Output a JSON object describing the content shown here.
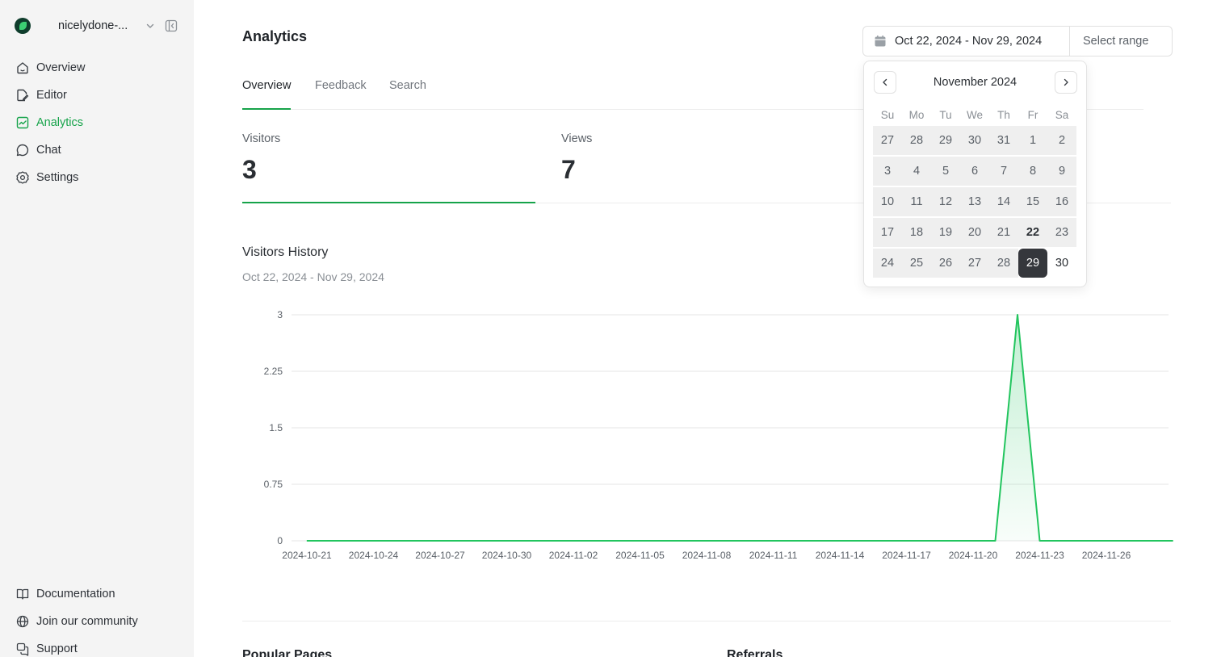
{
  "sidebar": {
    "org_name": "nicelydone-...",
    "items": [
      {
        "label": "Overview",
        "icon": "home-icon"
      },
      {
        "label": "Editor",
        "icon": "edit-icon"
      },
      {
        "label": "Analytics",
        "icon": "chart-icon",
        "active": true
      },
      {
        "label": "Chat",
        "icon": "chat-icon"
      },
      {
        "label": "Settings",
        "icon": "gear-icon"
      }
    ],
    "footer_items": [
      {
        "label": "Documentation",
        "icon": "book-icon"
      },
      {
        "label": "Join our community",
        "icon": "globe-icon"
      },
      {
        "label": "Support",
        "icon": "support-icon"
      }
    ]
  },
  "header": {
    "title": "Analytics",
    "date_range": "Oct 22, 2024 - Nov 29, 2024",
    "select_range": "Select range"
  },
  "tabs": [
    "Overview",
    "Feedback",
    "Search"
  ],
  "stats": [
    {
      "label": "Visitors",
      "value": "3"
    },
    {
      "label": "Views",
      "value": "7"
    }
  ],
  "history": {
    "title": "Visitors History",
    "subtitle": "Oct 22, 2024 - Nov 29, 2024"
  },
  "chart_data": {
    "type": "area",
    "title": "",
    "xlabel": "",
    "ylabel": "",
    "ylim": [
      0,
      3
    ],
    "y_ticks": [
      "0",
      "0.75",
      "1.5",
      "2.25",
      "3"
    ],
    "x_ticks": [
      "2024-10-21",
      "2024-10-24",
      "2024-10-27",
      "2024-10-30",
      "2024-11-02",
      "2024-11-05",
      "2024-11-08",
      "2024-11-11",
      "2024-11-14",
      "2024-11-17",
      "2024-11-20",
      "2024-11-23",
      "2024-11-26"
    ],
    "x": [
      "2024-10-21",
      "2024-11-20",
      "2024-11-21",
      "2024-11-22",
      "2024-11-23",
      "2024-11-24",
      "2024-11-25",
      "2024-11-26",
      "2024-11-27",
      "2024-11-28",
      "2024-11-29"
    ],
    "values": [
      0,
      0,
      0,
      3,
      0,
      0,
      0,
      0,
      0,
      0,
      0
    ],
    "grid": true,
    "color": "#22c55e"
  },
  "calendar": {
    "month": "November 2024",
    "weekdays": [
      "Su",
      "Mo",
      "Tu",
      "We",
      "Th",
      "Fr",
      "Sa"
    ],
    "weeks": [
      [
        "27",
        "28",
        "29",
        "30",
        "31",
        "1",
        "2"
      ],
      [
        "3",
        "4",
        "5",
        "6",
        "7",
        "8",
        "9"
      ],
      [
        "10",
        "11",
        "12",
        "13",
        "14",
        "15",
        "16"
      ],
      [
        "17",
        "18",
        "19",
        "20",
        "21",
        "22",
        "23"
      ],
      [
        "24",
        "25",
        "26",
        "27",
        "28",
        "29",
        "30"
      ]
    ],
    "selected": "29",
    "today": "22"
  },
  "bottom_sections": [
    "Popular Pages",
    "Referrals"
  ],
  "colors": {
    "accent": "#16a34a",
    "chart_line": "#22c55e"
  }
}
